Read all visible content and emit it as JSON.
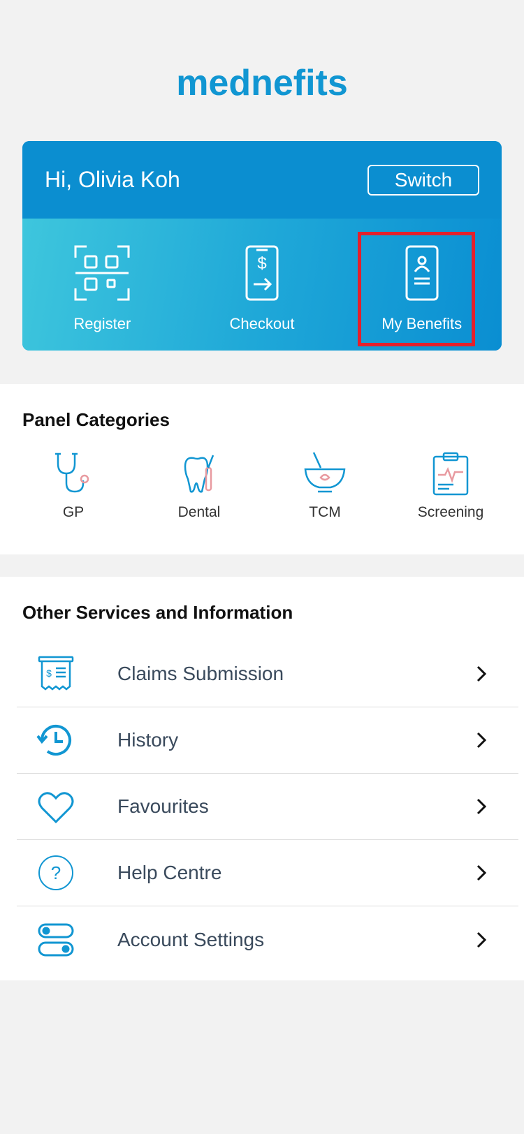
{
  "logo": {
    "text": "mednefits"
  },
  "user_card": {
    "greeting": "Hi, Olivia Koh",
    "switch_label": "Switch",
    "actions": [
      {
        "label": "Register",
        "icon": "qr-scan-icon"
      },
      {
        "label": "Checkout",
        "icon": "phone-dollar-icon"
      },
      {
        "label": "My Benefits",
        "icon": "member-card-icon"
      }
    ]
  },
  "panel_categories": {
    "title": "Panel Categories",
    "items": [
      {
        "label": "GP",
        "icon": "stethoscope-icon"
      },
      {
        "label": "Dental",
        "icon": "tooth-icon"
      },
      {
        "label": "TCM",
        "icon": "mortar-pestle-icon"
      },
      {
        "label": "Screening",
        "icon": "clipboard-icon"
      }
    ]
  },
  "other_services": {
    "title": "Other Services and Information",
    "items": [
      {
        "label": "Claims Submission",
        "icon": "receipt-icon"
      },
      {
        "label": "History",
        "icon": "history-icon"
      },
      {
        "label": "Favourites",
        "icon": "heart-icon"
      },
      {
        "label": "Help Centre",
        "icon": "help-icon"
      },
      {
        "label": "Account Settings",
        "icon": "settings-toggle-icon"
      }
    ]
  },
  "colors": {
    "brand": "#1196d2",
    "highlight": "#e3202c",
    "accent_pink": "#e89aa0"
  }
}
